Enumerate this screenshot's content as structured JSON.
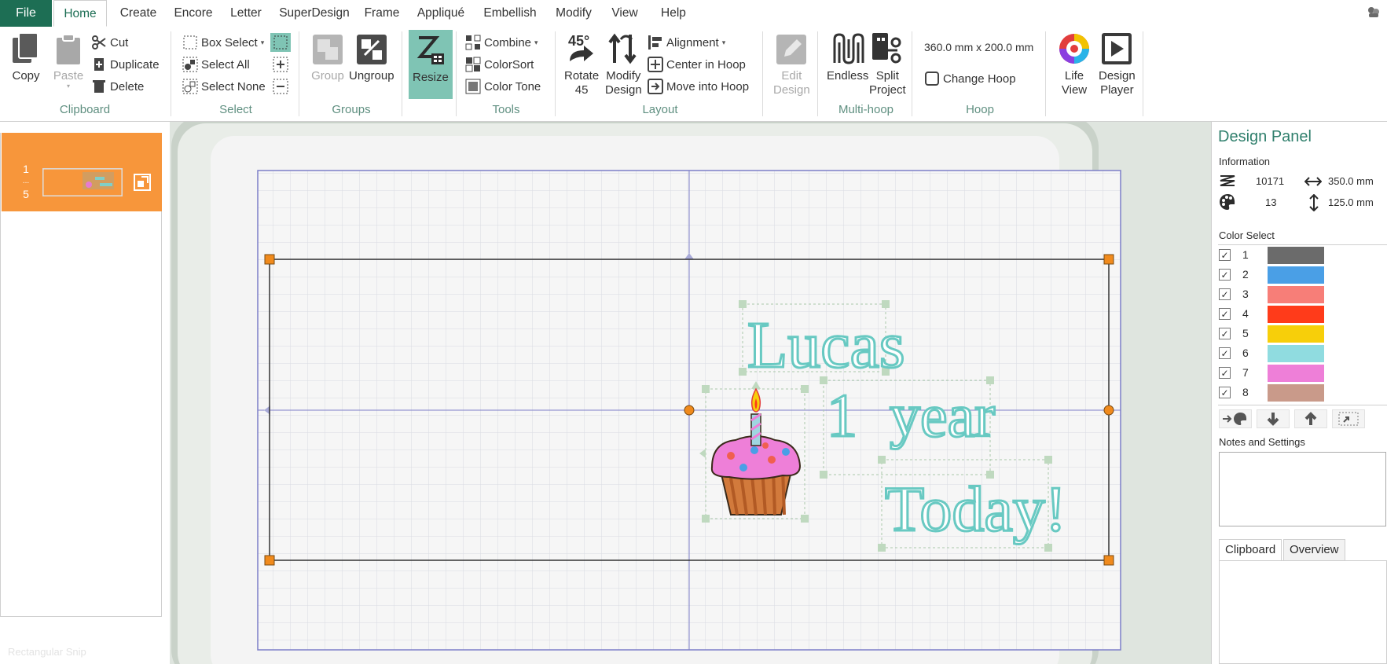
{
  "menu": {
    "file": "File",
    "tabs": [
      "Home",
      "Create",
      "Encore",
      "Letter",
      "SuperDesign",
      "Frame",
      "Appliqué",
      "Embellish",
      "Modify",
      "View",
      "Help"
    ],
    "active_tab": "Home"
  },
  "ribbon": {
    "clipboard": {
      "label": "Clipboard",
      "copy": "Copy",
      "paste": "Paste",
      "cut": "Cut",
      "duplicate": "Duplicate",
      "delete": "Delete"
    },
    "select": {
      "label": "Select",
      "box_select": "Box Select",
      "select_all": "Select All",
      "select_none": "Select None"
    },
    "groups": {
      "label": "Groups",
      "group": "Group",
      "ungroup": "Ungroup"
    },
    "resize": {
      "label": "Resize"
    },
    "tools": {
      "label": "Tools",
      "combine": "Combine",
      "colorsort": "ColorSort",
      "color_tone": "Color Tone"
    },
    "layout": {
      "label": "Layout",
      "rotate_line1": "Rotate",
      "rotate_line2": "45",
      "modify_line1": "Modify",
      "modify_line2": "Design",
      "alignment": "Alignment",
      "center_in_hoop": "Center in Hoop",
      "move_into_hoop": "Move into Hoop"
    },
    "edit_design": {
      "line1": "Edit",
      "line2": "Design"
    },
    "multihoop": {
      "label": "Multi-hoop",
      "endless": "Endless",
      "split_line1": "Split",
      "split_line2": "Project"
    },
    "hoop": {
      "label": "Hoop",
      "size": "360.0 mm x 200.0 mm",
      "change_hoop": "Change Hoop"
    },
    "view": {
      "life_line1": "Life",
      "life_line2": "View",
      "player_line1": "Design",
      "player_line2": "Player"
    }
  },
  "hoop_list": {
    "range_start": "1",
    "range_sep": "...",
    "range_end": "5",
    "snip_label": "Rectangular Snip"
  },
  "canvas": {
    "text_line1": "Lucas",
    "text_line2a": "1",
    "text_line2b": "year",
    "text_line3": "Today!",
    "colors": {
      "thread_teal": "#7fd6cf",
      "selection_orange": "#f08a1c",
      "hoop_blue": "#7d7fc8"
    }
  },
  "design_panel": {
    "title": "Design Panel",
    "information_label": "Information",
    "stitches": "10171",
    "width": "350.0 mm",
    "colors_count": "13",
    "height": "125.0 mm",
    "color_select_label": "Color Select",
    "colors": [
      {
        "num": "1",
        "hex": "#6b6b6b"
      },
      {
        "num": "2",
        "hex": "#4a9fe6"
      },
      {
        "num": "3",
        "hex": "#f77e78"
      },
      {
        "num": "4",
        "hex": "#ff3b1a"
      },
      {
        "num": "5",
        "hex": "#f7cf0a"
      },
      {
        "num": "6",
        "hex": "#90dce0"
      },
      {
        "num": "7",
        "hex": "#ee7fd8"
      },
      {
        "num": "8",
        "hex": "#c99a8a"
      }
    ],
    "notes_label": "Notes and Settings",
    "bottom_tabs": [
      "Clipboard",
      "Overview"
    ]
  }
}
